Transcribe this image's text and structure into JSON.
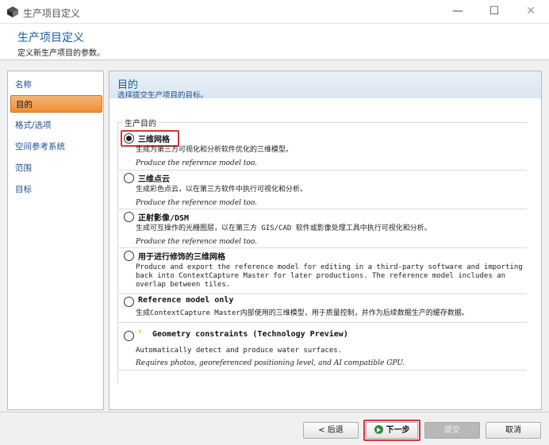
{
  "window": {
    "title": "生产项目定义",
    "min_glyph": "—",
    "max_glyph": "☐",
    "close_glyph": "✕"
  },
  "header": {
    "title": "生产项目定义",
    "subtitle": "定义新生产项目的参数。"
  },
  "sidebar": {
    "items": [
      {
        "label": "名称",
        "active": false
      },
      {
        "label": "目的",
        "active": true
      },
      {
        "label": "格式/选项",
        "active": false
      },
      {
        "label": "空间参考系统",
        "active": false
      },
      {
        "label": "范围",
        "active": false
      },
      {
        "label": "目标",
        "active": false
      }
    ]
  },
  "content": {
    "title": "目的",
    "subtitle": "选择提交生产项目的目标。",
    "group_label": "生产目的",
    "options": [
      {
        "label": "三维网格",
        "selected": true,
        "desc": "生成为第三方可视化和分析软件优化的三维模型。",
        "note": "Produce the reference model too."
      },
      {
        "label": "三维点云",
        "selected": false,
        "desc": "生成彩色点云，以在第三方软件中执行可视化和分析。",
        "note": "Produce the reference model too."
      },
      {
        "label": "正射影像/DSM",
        "selected": false,
        "desc": "生成可互操作的光栅图层，以在第三方 GIS/CAD 软件或影像处理工具中执行可视化和分析。",
        "note": "Produce the reference model too."
      },
      {
        "label": "用于进行修饰的三维网格",
        "selected": false,
        "desc": "Produce and export the reference model for editing in a third-party software and importing back into ContextCapture Master for later productions. The reference model includes an overlap between tiles.",
        "note": ""
      },
      {
        "label": "Reference model only",
        "selected": false,
        "desc": "生成ContextCapture Master内部使用的三维模型，用于质量控制，并作为后续数据生产的缓存数据。",
        "note": ""
      },
      {
        "label": "Geometry constraints (Technology Preview)",
        "selected": false,
        "desc": "Automatically detect and produce water surfaces.",
        "note": "Requires photos, georeferenced positioning level, and AI compatible GPU."
      }
    ]
  },
  "footer": {
    "back_label": "< 后退",
    "next_label": "下一步",
    "submit_label": "提交",
    "cancel_label": "取消"
  },
  "colors": {
    "accent": "#1b5a9a",
    "active_tab": "#ef8e35",
    "highlight": "#d6333a",
    "next_icon": "#2f8a3a"
  }
}
